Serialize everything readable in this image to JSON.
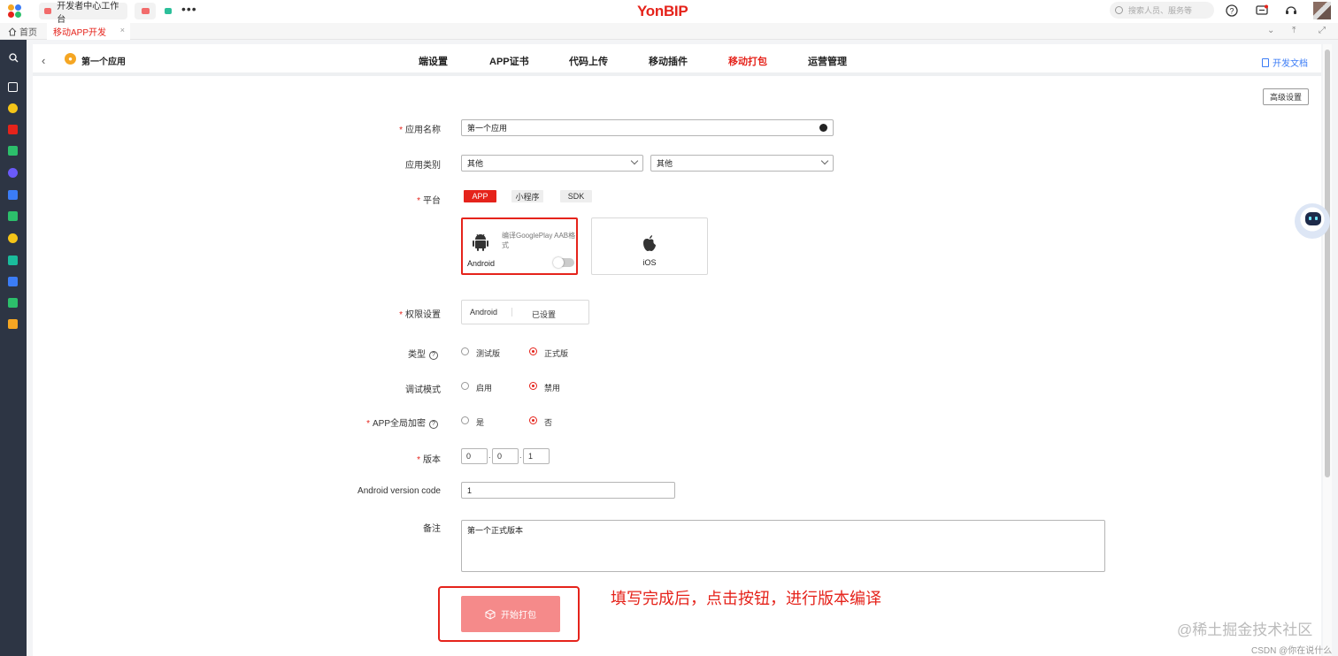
{
  "topbar": {
    "tab1_label": "开发者中心工作台",
    "brand": "YonBIP",
    "search_placeholder": "搜索人员、服务等"
  },
  "tabs": {
    "home_label": "首页",
    "active_label": "移动APP开发",
    "close": "×"
  },
  "subheader": {
    "app_name": "第一个应用",
    "app_logo": "●",
    "nav": [
      "端设置",
      "APP证书",
      "代码上传",
      "移动插件",
      "移动打包",
      "运营管理"
    ],
    "active_nav": "移动打包",
    "dev_doc": "开发文档"
  },
  "advanced_button": "高级设置",
  "form": {
    "app_name": {
      "label": "应用名称",
      "value": "第一个应用"
    },
    "app_category": {
      "label": "应用类别",
      "value1": "其他",
      "value2": "其他"
    },
    "platform": {
      "label": "平台",
      "options": [
        "APP",
        "小程序",
        "SDK"
      ],
      "selected": "APP",
      "android_card": {
        "title": "Android",
        "note": "编译GooglePlay AAB格式",
        "toggle_on": false
      },
      "ios_card": {
        "title": "iOS"
      }
    },
    "permission": {
      "label": "权限设置",
      "platform": "Android",
      "status": "已设置"
    },
    "type": {
      "label": "类型",
      "options": [
        "测试版",
        "正式版"
      ],
      "selected": "正式版"
    },
    "debug_mode": {
      "label": "调试模式",
      "options": [
        "启用",
        "禁用"
      ],
      "selected": "禁用"
    },
    "encryption": {
      "label": "APP全局加密",
      "options": [
        "是",
        "否"
      ],
      "selected": "否"
    },
    "version": {
      "label": "版本",
      "major": "0",
      "minor": "0",
      "patch": "1",
      "separator": "."
    },
    "android_version_code": {
      "label": "Android version code",
      "value": "1"
    },
    "remark": {
      "label": "备注",
      "value": "第一个正式版本"
    },
    "required_mark": "*",
    "help_mark": "?"
  },
  "start_button": "开始打包",
  "annotation": "填写完成后，点击按钮，进行版本编译",
  "watermark": "@稀土掘金技术社区",
  "watermark_small": "CSDN @你在说什么",
  "colors": {
    "accent": "#e5231b",
    "sidebar": "#2d3544",
    "link": "#3b7cf6"
  },
  "icons": [
    "apps-icon",
    "more-icon",
    "search-icon",
    "help-icon",
    "message-icon",
    "support-icon",
    "home-icon",
    "close-icon",
    "back-icon",
    "document-icon",
    "globe-icon",
    "android-icon",
    "apple-icon",
    "package-icon",
    "robot-assistant-icon"
  ]
}
